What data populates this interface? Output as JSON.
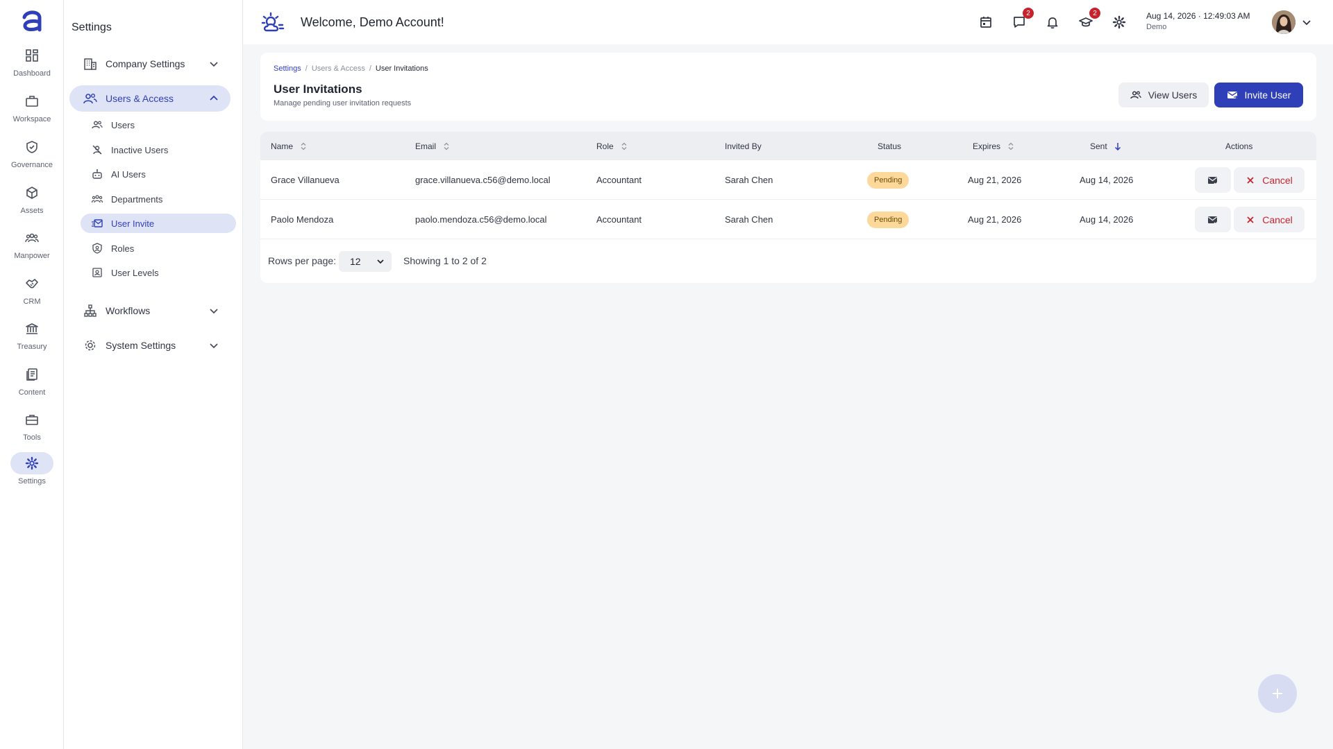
{
  "rail": {
    "items": [
      {
        "label": "Dashboard",
        "icon": "dashboard-icon"
      },
      {
        "label": "Workspace",
        "icon": "briefcase-icon"
      },
      {
        "label": "Governance",
        "icon": "shield-check-icon"
      },
      {
        "label": "Assets",
        "icon": "cube-icon"
      },
      {
        "label": "Manpower",
        "icon": "people-group-icon"
      },
      {
        "label": "CRM",
        "icon": "handshake-icon"
      },
      {
        "label": "Treasury",
        "icon": "bank-icon"
      },
      {
        "label": "Content",
        "icon": "documents-icon"
      },
      {
        "label": "Tools",
        "icon": "toolbox-icon"
      },
      {
        "label": "Settings",
        "icon": "gear-icon"
      }
    ],
    "active": "Settings"
  },
  "panel": {
    "title": "Settings",
    "groups": {
      "company": "Company Settings",
      "users_access": "Users & Access",
      "workflows": "Workflows",
      "system": "System Settings"
    },
    "sub_items": [
      "Users",
      "Inactive Users",
      "AI Users",
      "Departments",
      "User Invite",
      "Roles",
      "User Levels"
    ],
    "active_sub": "User Invite"
  },
  "header": {
    "welcome": "Welcome, Demo Account!",
    "messages_badge": "2",
    "learning_badge": "2",
    "date": "Aug 14, 2026",
    "separator": "·",
    "time": "12:49:03 AM",
    "account": "Demo"
  },
  "page": {
    "breadcrumb": [
      "Settings",
      "/",
      "Users & Access",
      "/",
      "User Invitations"
    ],
    "title": "User Invitations",
    "subtitle": "Manage pending user invitation requests",
    "view_users_label": "View Users",
    "invite_user_label": "Invite User"
  },
  "table": {
    "columns": {
      "name": "Name",
      "email": "Email",
      "role": "Role",
      "invited_by": "Invited By",
      "status": "Status",
      "expires": "Expires",
      "sent": "Sent",
      "actions": "Actions"
    },
    "rows": [
      {
        "name": "Grace Villanueva",
        "email": "grace.villanueva.c56@demo.local",
        "role": "Accountant",
        "invited_by": "Sarah Chen",
        "status": "Pending",
        "expires": "Aug 21, 2026",
        "sent": "Aug 14, 2026",
        "cancel_label": "Cancel"
      },
      {
        "name": "Paolo Mendoza",
        "email": "paolo.mendoza.c56@demo.local",
        "role": "Accountant",
        "invited_by": "Sarah Chen",
        "status": "Pending",
        "expires": "Aug 21, 2026",
        "sent": "Aug 14, 2026",
        "cancel_label": "Cancel"
      }
    ],
    "rows_per_page_label": "Rows per page:",
    "rows_per_page_value": "12",
    "showing": "Showing 1 to 2 of 2"
  },
  "colors": {
    "accent": "#2f3fb8",
    "accent_soft": "#dfe3f6",
    "danger": "#c8232c",
    "pending_bg": "#fcd99a"
  }
}
